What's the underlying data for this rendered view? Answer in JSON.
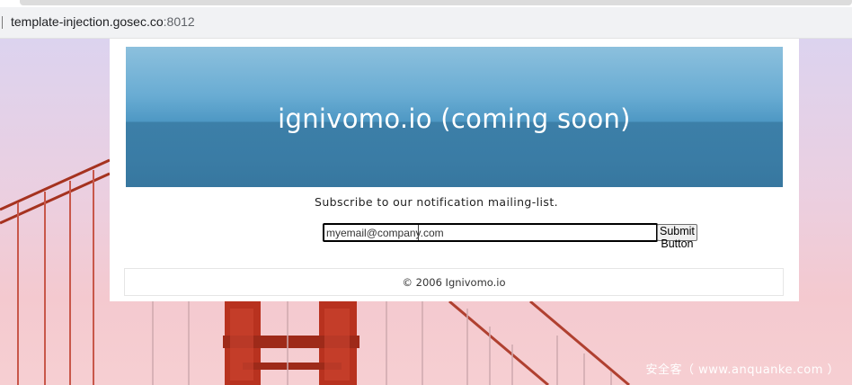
{
  "browser": {
    "url_host": "template-injection.gosec.co",
    "url_port": ":8012"
  },
  "page": {
    "banner_title": "ignivomo.io (coming soon)",
    "subscribe_text": "Subscribe to our notification mailing-list.",
    "email_value": "myemail@company.com",
    "submit_label": "Submit Button",
    "footer_text": "© 2006 Ignivomo.io"
  },
  "watermark": "安全客（ www.anquanke.com ）",
  "colors": {
    "banner_top": "#8cc0dd",
    "banner_bottom": "#37779f",
    "bridge_red": "#c0392b"
  }
}
